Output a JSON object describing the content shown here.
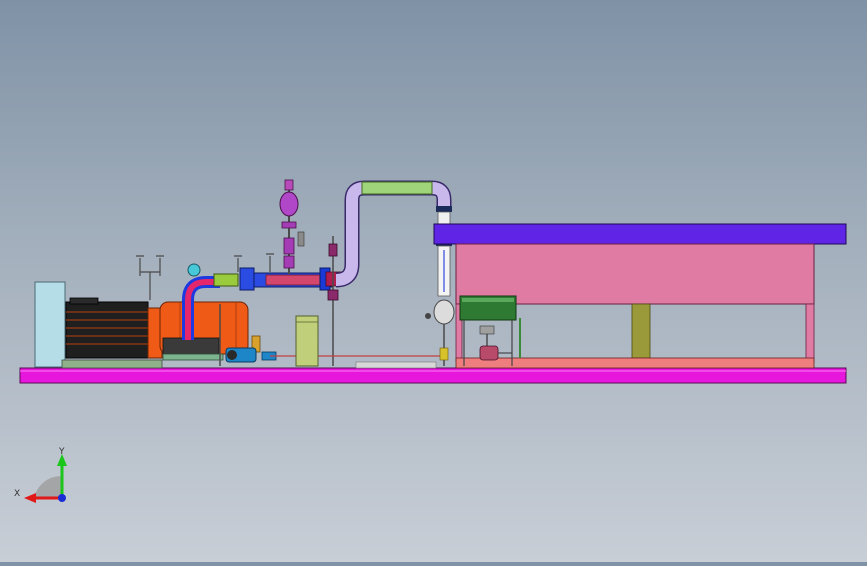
{
  "viewport": {
    "background_top": "#7f92a6",
    "background_bottom": "#c8ced6"
  },
  "triad": {
    "x_label": "X",
    "y_label": "Y",
    "x_color": "#e01818",
    "y_color": "#19c619",
    "z_color": "#1a2cd6"
  },
  "colors": {
    "base_frame": "#e616dc",
    "tank_roof": "#5f24e6",
    "tank_body": "#e07ba3",
    "motor_housing": "#1f1f1f",
    "pump_casing": "#ef5a17",
    "electrical_cabinet": "#b4dde8",
    "pipe_upper": "#9fd47a",
    "pipe_riser": "#c8b8ec",
    "control_box": "#2f7a32"
  }
}
